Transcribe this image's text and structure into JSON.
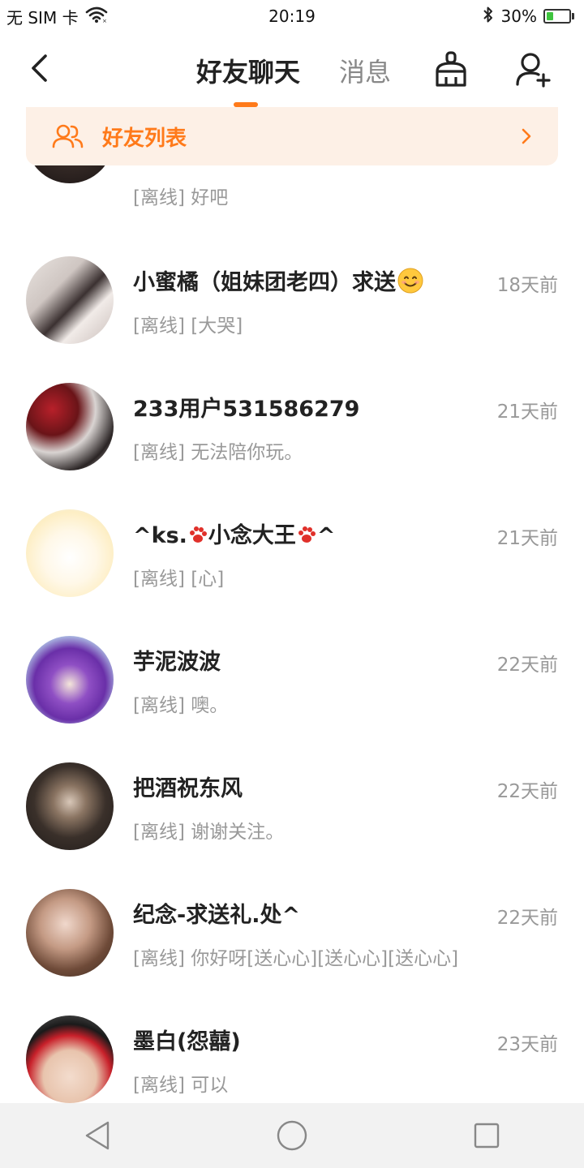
{
  "status_bar": {
    "carrier": "无 SIM 卡",
    "time": "20:19",
    "battery_text": "30%",
    "battery_level": 0.3,
    "icons": [
      "wifi-icon",
      "bluetooth-icon",
      "battery-icon"
    ]
  },
  "header": {
    "tab_chat": "好友聊天",
    "tab_messages": "消息",
    "active_tab": "tab_chat",
    "accent_color": "#ff7a1a",
    "icons": [
      "back-arrow-icon",
      "broom-icon",
      "add-friend-icon"
    ]
  },
  "banner": {
    "label": "好友列表",
    "icons": [
      "friends-icon",
      "chevron-right-icon"
    ],
    "background": "#fdf0e6"
  },
  "friends": [
    {
      "name": "",
      "message": "[离线] 好吧",
      "time": ""
    },
    {
      "name": "小蜜橘（姐妹团老四）求送",
      "name_suffix_icon": "smile-emoji-icon",
      "message": "[离线] [大哭]",
      "time": "18天前"
    },
    {
      "name": "233用户531586279",
      "message": "[离线] 无法陪你玩。",
      "time": "21天前"
    },
    {
      "name_part1": "^ks.",
      "name_part2": "小念大王",
      "name_part3": "^",
      "name_icons": [
        "paw-icon",
        "paw-icon"
      ],
      "message": "[离线] [心]",
      "time": "21天前"
    },
    {
      "name": "芋泥波波",
      "message": "[离线] 噢。",
      "time": "22天前"
    },
    {
      "name": "把酒祝东风",
      "message": "[离线] 谢谢关注。",
      "time": "22天前"
    },
    {
      "name": "纪念-求送礼.处^",
      "message": "[离线] 你好呀[送心心][送心心][送心心]",
      "time": "22天前"
    },
    {
      "name": "墨白(怨囍)",
      "message": "[离线] 可以",
      "time": "23天前"
    }
  ],
  "system_nav": {
    "icons": [
      "back-triangle-icon",
      "home-circle-icon",
      "recents-square-icon"
    ]
  }
}
